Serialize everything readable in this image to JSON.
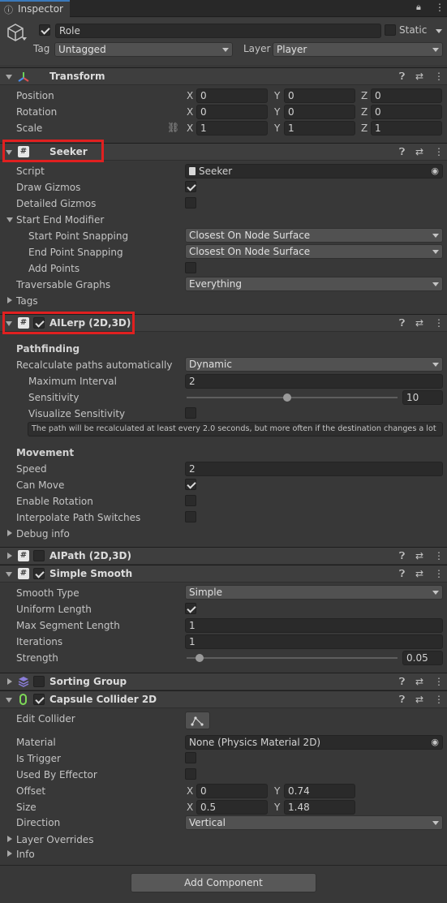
{
  "tab": {
    "label": "Inspector"
  },
  "object": {
    "name": "Role",
    "static_label": "Static",
    "tag_label": "Tag",
    "tag_value": "Untagged",
    "layer_label": "Layer",
    "layer_value": "Player"
  },
  "transform": {
    "title": "Transform",
    "position_label": "Position",
    "rotation_label": "Rotation",
    "scale_label": "Scale",
    "x": "X",
    "y": "Y",
    "z": "Z",
    "position": [
      "0",
      "0",
      "0"
    ],
    "rotation": [
      "0",
      "0",
      "0"
    ],
    "scale": [
      "1",
      "1",
      "1"
    ]
  },
  "seeker": {
    "title": "Seeker",
    "script_label": "Script",
    "script_value": "Seeker",
    "draw_gizmos_label": "Draw Gizmos",
    "draw_gizmos": true,
    "detailed_gizmos_label": "Detailed Gizmos",
    "detailed_gizmos": false,
    "start_end_label": "Start End Modifier",
    "start_snap_label": "Start Point Snapping",
    "start_snap_value": "Closest On Node Surface",
    "end_snap_label": "End Point Snapping",
    "end_snap_value": "Closest On Node Surface",
    "add_points_label": "Add Points",
    "add_points": false,
    "traversable_label": "Traversable Graphs",
    "traversable_value": "Everything",
    "tags_label": "Tags"
  },
  "ailerp": {
    "title": "AILerp (2D,3D)",
    "pathfinding_label": "Pathfinding",
    "recalc_label": "Recalculate paths automatically",
    "recalc_value": "Dynamic",
    "max_interval_label": "Maximum Interval",
    "max_interval_value": "2",
    "sensitivity_label": "Sensitivity",
    "sensitivity_value": "10",
    "sensitivity_fraction": 0.47,
    "visualize_label": "Visualize Sensitivity",
    "help_text": "The path will be recalculated at least every 2.0 seconds, but more often if the destination changes a lot",
    "movement_label": "Movement",
    "speed_label": "Speed",
    "speed_value": "2",
    "can_move_label": "Can Move",
    "enable_rotation_label": "Enable Rotation",
    "interp_label": "Interpolate Path Switches",
    "debug_label": "Debug info"
  },
  "aipath": {
    "title": "AIPath (2D,3D)"
  },
  "simple_smooth": {
    "title": "Simple Smooth",
    "type_label": "Smooth Type",
    "type_value": "Simple",
    "uniform_label": "Uniform Length",
    "max_seg_label": "Max Segment Length",
    "max_seg_value": "1",
    "iterations_label": "Iterations",
    "iterations_value": "1",
    "strength_label": "Strength",
    "strength_value": "0.05",
    "strength_fraction": 0.05
  },
  "sorting_group": {
    "title": "Sorting Group"
  },
  "capsule": {
    "title": "Capsule Collider 2D",
    "edit_label": "Edit Collider",
    "material_label": "Material",
    "material_value": "None (Physics Material 2D)",
    "trigger_label": "Is Trigger",
    "effector_label": "Used By Effector",
    "offset_label": "Offset",
    "offset_x": "0",
    "offset_y": "0.74",
    "size_label": "Size",
    "size_x": "0.5",
    "size_y": "1.48",
    "direction_label": "Direction",
    "direction_value": "Vertical",
    "layer_overrides_label": "Layer Overrides",
    "info_label": "Info"
  },
  "add_component": "Add Component"
}
